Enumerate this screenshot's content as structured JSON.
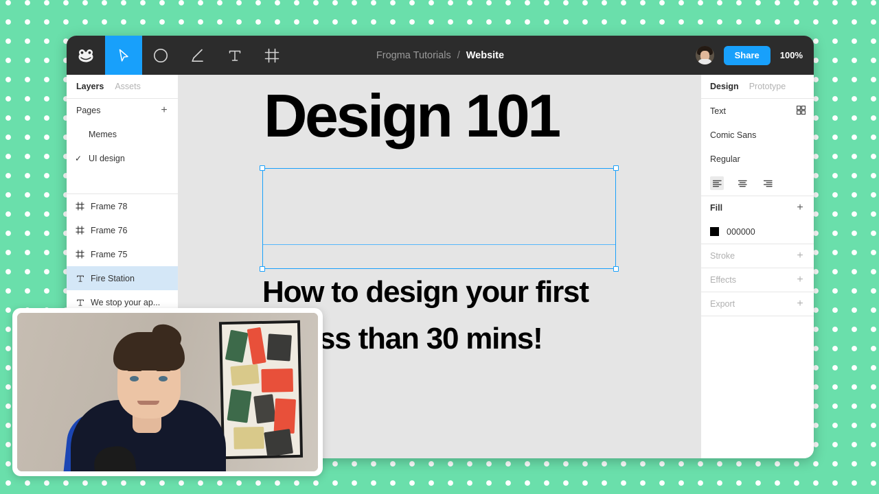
{
  "background": {
    "color": "#6adfab",
    "dot_color": "#ffffff"
  },
  "toolbar": {
    "tools": [
      {
        "name": "frogma-logo-icon",
        "label": "Frogma"
      },
      {
        "name": "move-tool",
        "label": "Move",
        "active": true
      },
      {
        "name": "shape-tool",
        "label": "Ellipse"
      },
      {
        "name": "pen-tool",
        "label": "Pen"
      },
      {
        "name": "text-tool",
        "label": "Text"
      },
      {
        "name": "frame-tool",
        "label": "Frame"
      }
    ],
    "breadcrumb": {
      "project": "Frogma Tutorials",
      "separator": "/",
      "file": "Website"
    },
    "share_label": "Share",
    "zoom_level": "100%",
    "accent_color": "#18a0fb",
    "bar_color": "#2c2c2c"
  },
  "left_panel": {
    "tabs": [
      {
        "label": "Layers",
        "active": true
      },
      {
        "label": "Assets",
        "active": false
      }
    ],
    "pages_label": "Pages",
    "add_page_label": "+",
    "pages": [
      {
        "label": "Memes",
        "selected": false
      },
      {
        "label": "UI design",
        "selected": true,
        "check": "✓"
      }
    ],
    "layers": [
      {
        "label": "Frame 78",
        "icon": "frame-icon",
        "selected": false
      },
      {
        "label": "Frame 76",
        "icon": "frame-icon",
        "selected": false
      },
      {
        "label": "Frame 75",
        "icon": "frame-icon",
        "selected": false
      },
      {
        "label": "Fire Station",
        "icon": "text-icon",
        "selected": true
      },
      {
        "label": "We stop your ap...",
        "icon": "text-icon",
        "selected": false
      }
    ]
  },
  "canvas": {
    "background": "#e5e5e5",
    "heading": "Design 101",
    "subtitle_line_1": "How to design your first",
    "subtitle_line_2": "in less than 30 mins!",
    "selection_color": "#18a0fb"
  },
  "right_panel": {
    "tabs": [
      {
        "label": "Design",
        "active": true
      },
      {
        "label": "Prototype",
        "active": false
      }
    ],
    "text_section": {
      "label": "Text",
      "grid_icon": "style-grid-icon",
      "font_family": "Comic Sans",
      "font_weight": "Regular",
      "alignments": [
        {
          "name": "align-left-icon",
          "active": true
        },
        {
          "name": "align-center-icon",
          "active": false
        },
        {
          "name": "align-right-icon",
          "active": false
        }
      ]
    },
    "fill": {
      "label": "Fill",
      "add_label": "+",
      "color_hex": "000000",
      "swatch": "#000000"
    },
    "sections": [
      {
        "label": "Stroke",
        "add_label": "+"
      },
      {
        "label": "Effects",
        "add_label": "+"
      },
      {
        "label": "Export",
        "add_label": "+"
      }
    ]
  },
  "webcam": {
    "name": "presenter-webcam-overlay",
    "border_color": "#ffffff"
  }
}
